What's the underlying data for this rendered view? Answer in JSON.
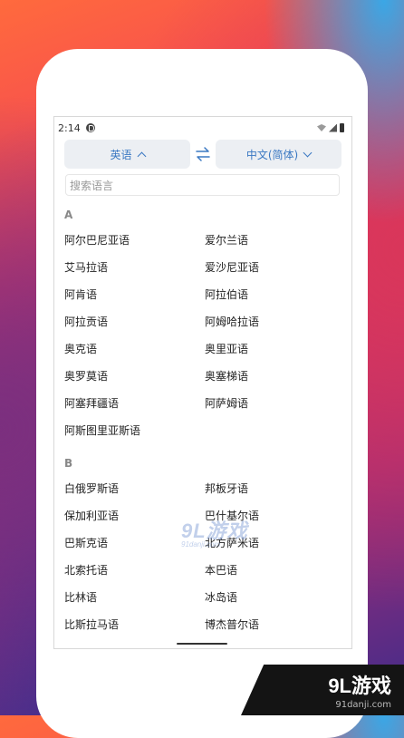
{
  "status_bar": {
    "time": "2:14"
  },
  "lang_bar": {
    "source": "英语",
    "target": "中文(简体)"
  },
  "search": {
    "placeholder": "搜索语言"
  },
  "sections": [
    {
      "letter": "A",
      "items": [
        "阿尔巴尼亚语",
        "爱尔兰语",
        "艾马拉语",
        "爱沙尼亚语",
        "阿肯语",
        "阿拉伯语",
        "阿拉贡语",
        "阿姆哈拉语",
        "奥克语",
        "奥里亚语",
        "奥罗莫语",
        "奥塞梯语",
        "阿塞拜疆语",
        "阿萨姆语",
        "阿斯图里亚斯语"
      ]
    },
    {
      "letter": "B",
      "items": [
        "白俄罗斯语",
        "邦板牙语",
        "保加利亚语",
        "巴什基尔语",
        "巴斯克语",
        "北方萨米语",
        "北索托语",
        "本巴语",
        "比林语",
        "冰岛语",
        "比斯拉马语",
        "博杰普尔语"
      ]
    }
  ],
  "watermark": {
    "brand": "9L游戏",
    "site": "91danji.com"
  }
}
